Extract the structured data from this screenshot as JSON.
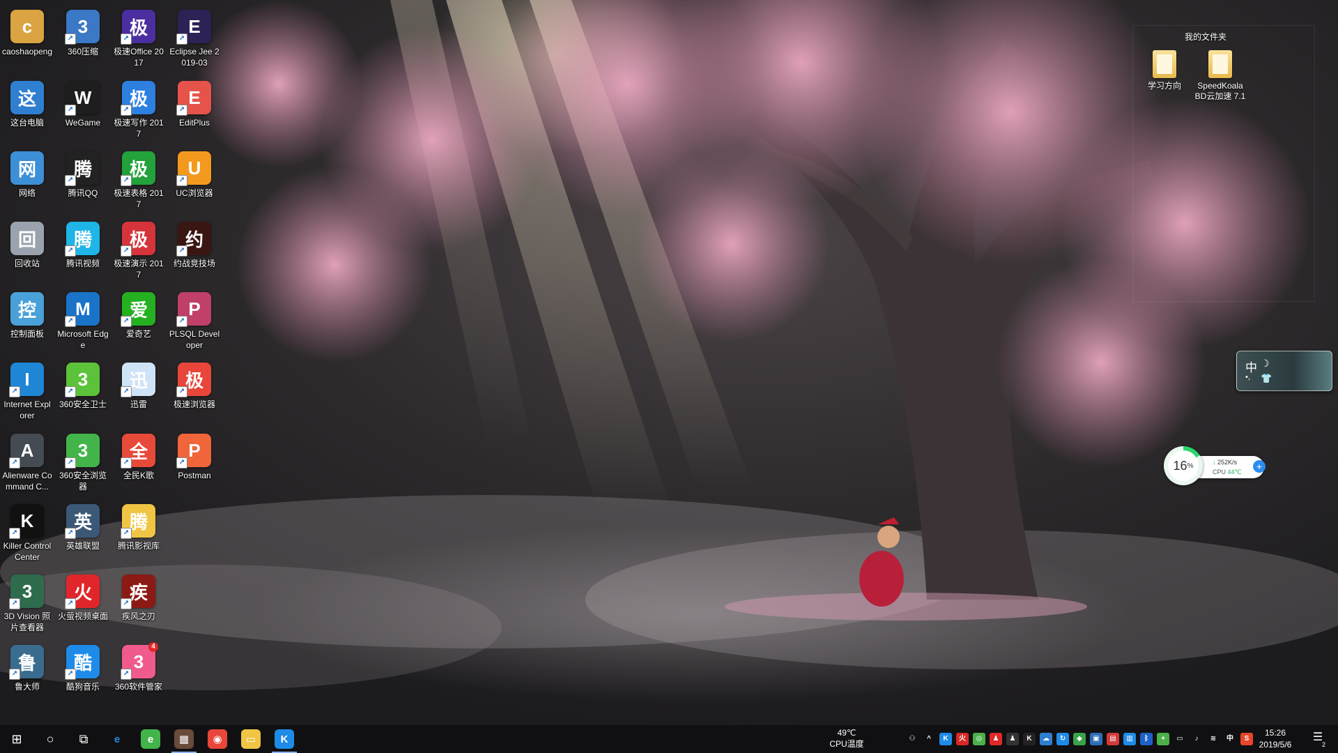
{
  "desktop_icons": [
    {
      "label": "caoshaopeng",
      "icon": "user-folder-icon",
      "color": "#d9a441"
    },
    {
      "label": "这台电脑",
      "icon": "computer-icon",
      "color": "#2f7fd1"
    },
    {
      "label": "网络",
      "icon": "network-globe-icon",
      "color": "#3d8fd6"
    },
    {
      "label": "回收站",
      "icon": "recycle-bin-icon",
      "color": "#9aa3ad"
    },
    {
      "label": "控制面板",
      "icon": "control-panel-icon",
      "color": "#4aa0d8"
    },
    {
      "label": "Internet Explorer",
      "icon": "ie-icon",
      "color": "#1f86d6"
    },
    {
      "label": "Alienware Command C...",
      "icon": "alienware-icon",
      "color": "#444b52"
    },
    {
      "label": "Killer Control Center",
      "icon": "killer-icon",
      "color": "#111111"
    },
    {
      "label": "3D Vision 照片查看器",
      "icon": "3d-vision-icon",
      "color": "#2f6b4d"
    },
    {
      "label": "鲁大师",
      "icon": "ludashi-icon",
      "color": "#3a6c8f"
    },
    {
      "label": "360压缩",
      "icon": "360-zip-icon",
      "color": "#3b78c6"
    },
    {
      "label": "WeGame",
      "icon": "wegame-icon",
      "color": "#1e1e1e"
    },
    {
      "label": "腾讯QQ",
      "icon": "qq-penguin-icon",
      "color": "#222222"
    },
    {
      "label": "腾讯视频",
      "icon": "tencent-video-icon",
      "color": "#1fb5e6"
    },
    {
      "label": "Microsoft Edge",
      "icon": "edge-icon",
      "color": "#1a73c8"
    },
    {
      "label": "360安全卫士",
      "icon": "360-guard-icon",
      "color": "#5cc23a"
    },
    {
      "label": "360安全浏览器",
      "icon": "360-browser-icon",
      "color": "#42b44a"
    },
    {
      "label": "英雄联盟",
      "icon": "lol-icon",
      "color": "#3b5876"
    },
    {
      "label": "火萤视频桌面",
      "icon": "firefly-icon",
      "color": "#e0262a"
    },
    {
      "label": "酷狗音乐",
      "icon": "kugou-icon",
      "color": "#1e8be8"
    },
    {
      "label": "极速Office 2017",
      "icon": "office-icon",
      "color": "#4b2ea0"
    },
    {
      "label": "极速写作 2017",
      "icon": "writer-icon",
      "color": "#2d7fe0"
    },
    {
      "label": "极速表格 2017",
      "icon": "sheet-icon",
      "color": "#23a13b"
    },
    {
      "label": "极速演示 2017",
      "icon": "present-icon",
      "color": "#d6343b"
    },
    {
      "label": "爱奇艺",
      "icon": "iqiyi-icon",
      "color": "#24b020"
    },
    {
      "label": "迅雷",
      "icon": "xunlei-icon",
      "color": "#cfe3f7"
    },
    {
      "label": "全民K歌",
      "icon": "kge-icon",
      "color": "#e84a3a"
    },
    {
      "label": "腾讯影视库",
      "icon": "video-lib-folder-icon",
      "color": "#f0c544"
    },
    {
      "label": "疾风之刃",
      "icon": "jifeng-icon",
      "color": "#8c1a14"
    },
    {
      "label": "360软件管家",
      "icon": "360-softmgr-icon",
      "color": "#f05a8c",
      "badge": "4"
    },
    {
      "label": "Eclipse Jee 2019-03",
      "icon": "eclipse-icon",
      "color": "#2c2255"
    },
    {
      "label": "EditPlus",
      "icon": "editplus-icon",
      "color": "#e5534b"
    },
    {
      "label": "UC浏览器",
      "icon": "uc-browser-icon",
      "color": "#f39a1e"
    },
    {
      "label": "约战竞技场",
      "icon": "arena-icon",
      "color": "#3a1612"
    },
    {
      "label": "PLSQL Developer",
      "icon": "plsql-icon",
      "color": "#c0406a"
    },
    {
      "label": "极速浏览器",
      "icon": "chrome-icon",
      "color": "#e8463a"
    },
    {
      "label": "Postman",
      "icon": "postman-icon",
      "color": "#f0653a"
    }
  ],
  "fence": {
    "title": "我的文件夹",
    "items": [
      {
        "label": "学习方向"
      },
      {
        "label": "SpeedKoala BD云加速 7.1"
      }
    ]
  },
  "ime_widget": {
    "lang": "中",
    "moon": "☽",
    "shirt": "👕",
    "dots": "•,"
  },
  "monitor": {
    "cpu_percent": 16,
    "cpu_percent_text": "16",
    "percent_sign": "%",
    "net_speed": "252K/s",
    "cpu_label": "CPU",
    "cpu_temp": "44℃"
  },
  "taskbar": {
    "start_glyph": "⊞",
    "search_glyph": "○",
    "taskview_glyph": "⧉",
    "pinned": [
      {
        "name": "edge",
        "glyph": "e",
        "bg": "transparent",
        "fg": "#2a8be0"
      },
      {
        "name": "360-browser",
        "glyph": "e",
        "bg": "#42b44a",
        "fg": "#fff"
      },
      {
        "name": "app-pixel",
        "glyph": "▦",
        "bg": "#6a4a3a",
        "fg": "#fff",
        "active": true
      },
      {
        "name": "chrome",
        "glyph": "◉",
        "bg": "#e8463a",
        "fg": "#fff"
      },
      {
        "name": "file-explorer",
        "glyph": "▭",
        "bg": "#f0c544",
        "fg": "#fff"
      },
      {
        "name": "kugou",
        "glyph": "K",
        "bg": "#1e8be8",
        "fg": "#fff",
        "active": true
      }
    ],
    "temp_value": "49℃",
    "temp_label": "CPU温度",
    "tray": [
      {
        "name": "people",
        "glyph": "⚇",
        "bg": "transparent"
      },
      {
        "name": "chevron-up",
        "glyph": "^",
        "bg": "transparent"
      },
      {
        "name": "kugou",
        "glyph": "K",
        "bg": "#1e8be8"
      },
      {
        "name": "flame",
        "glyph": "火",
        "bg": "#d92626"
      },
      {
        "name": "360",
        "glyph": "◎",
        "bg": "#4bb049"
      },
      {
        "name": "qq",
        "glyph": "♟",
        "bg": "#e02828"
      },
      {
        "name": "penguin",
        "glyph": "♟",
        "bg": "#333"
      },
      {
        "name": "k-logo",
        "glyph": "K",
        "bg": "#222"
      },
      {
        "name": "cloud",
        "glyph": "☁",
        "bg": "#2f7fd1"
      },
      {
        "name": "sync",
        "glyph": "↻",
        "bg": "#1e8be8"
      },
      {
        "name": "shield",
        "glyph": "◆",
        "bg": "#3aa24a"
      },
      {
        "name": "box",
        "glyph": "▣",
        "bg": "#2d6fb6"
      },
      {
        "name": "grid",
        "glyph": "▤",
        "bg": "#d23a3a"
      },
      {
        "name": "onedrive",
        "glyph": "▥",
        "bg": "#1e8be8"
      },
      {
        "name": "bluetooth",
        "glyph": "ᛒ",
        "bg": "#1e60c8"
      },
      {
        "name": "360-plus",
        "glyph": "+",
        "bg": "#4bb049"
      },
      {
        "name": "battery",
        "glyph": "▭",
        "bg": "transparent"
      },
      {
        "name": "volume",
        "glyph": "♪",
        "bg": "transparent"
      },
      {
        "name": "wifi",
        "glyph": "≋",
        "bg": "transparent"
      },
      {
        "name": "ime",
        "glyph": "中",
        "bg": "transparent"
      },
      {
        "name": "sogou",
        "glyph": "S",
        "bg": "#e8452a"
      }
    ],
    "time": "15:26",
    "date": "2019/5/6",
    "notification_glyph": "☰",
    "notification_count": "2"
  }
}
